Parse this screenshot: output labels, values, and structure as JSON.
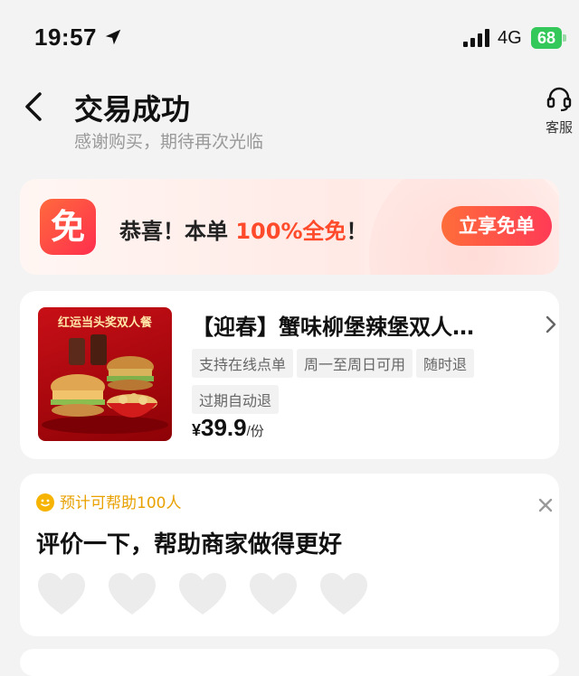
{
  "status_bar": {
    "time": "19:57",
    "network": "4G",
    "battery": "68"
  },
  "header": {
    "title": "交易成功",
    "subtitle": "感谢购买，期待再次光临",
    "service_label": "客服"
  },
  "promo": {
    "icon_text": "免",
    "text_prefix": "恭喜！本单 ",
    "text_highlight": "100%全免",
    "text_suffix": "！",
    "button_label": "立享免单"
  },
  "product": {
    "image_caption": "红运当头奖双人餐",
    "title": "【迎春】蟹味柳堡辣堡双人…",
    "tags": [
      "支持在线点单",
      "周一至周日可用",
      "随时退",
      "过期自动退"
    ],
    "price_currency": "¥",
    "price_amount": "39.9",
    "price_unit": "/份"
  },
  "review": {
    "help_text": "预计可帮助100人",
    "title": "评价一下，帮助商家做得更好",
    "rating_max": 5,
    "rating_value": 0
  },
  "colors": {
    "accent": "#ff4b2b",
    "help_text": "#e8a100",
    "battery": "#34c759"
  }
}
